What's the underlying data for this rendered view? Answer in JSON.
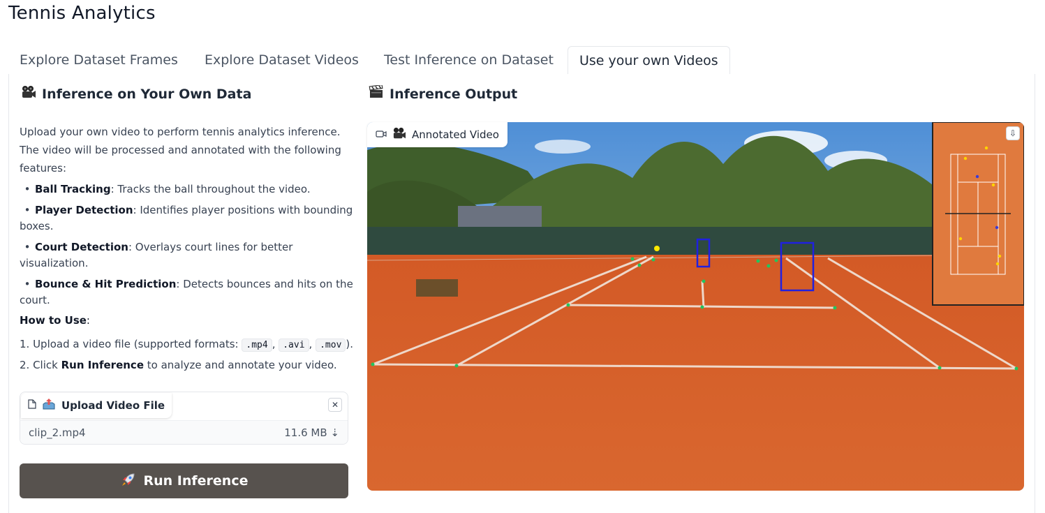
{
  "app": {
    "title": "Tennis Analytics"
  },
  "tabs": [
    {
      "label": "Explore Dataset Frames",
      "active": false
    },
    {
      "label": "Explore Dataset Videos",
      "active": false
    },
    {
      "label": "Test Inference on Dataset",
      "active": false
    },
    {
      "label": "Use your own Videos",
      "active": true
    }
  ],
  "left": {
    "title": "Inference on Your Own Data",
    "title_icon": "camera-emoji-icon",
    "description": "Upload your own video to perform tennis analytics inference. The video will be processed and annotated with the following features:",
    "features": [
      {
        "name": "Ball Tracking",
        "text": ": Tracks the ball throughout the video."
      },
      {
        "name": "Player Detection",
        "text": ": Identifies player positions with bounding boxes."
      },
      {
        "name": "Court Detection",
        "text": ": Overlays court lines for better visualization."
      },
      {
        "name": "Bounce & Hit Prediction",
        "text": ": Detects bounces and hits on the court."
      }
    ],
    "howto": {
      "label": "How to Use",
      "suffix": ":"
    },
    "steps": {
      "step1_prefix": "1. Upload a video file (supported formats: ",
      "formats": [
        ".mp4",
        ".avi",
        ".mov"
      ],
      "sep": ", ",
      "step1_suffix": ").",
      "step2_prefix": "2. Click ",
      "step2_bold": "Run Inference",
      "step2_suffix": " to analyze and annotate your video."
    },
    "upload": {
      "label": "Upload Video File",
      "file_name": "clip_2.mp4",
      "file_size": "11.6 MB",
      "download_glyph": "⇣",
      "clear_glyph": "✕"
    },
    "run_button": {
      "label": "Run Inference",
      "icon": "rocket-icon"
    }
  },
  "right": {
    "title": "Inference Output",
    "title_icon": "clapper-board-icon",
    "video_label": "Annotated Video",
    "download_glyph": "⇩"
  },
  "colors": {
    "clay": "#d8622c",
    "minimap": "#e07a3e",
    "player_box": "#2020e0",
    "keypoint": "#22c55e",
    "ball": "#ffea00",
    "button_bg": "#57524e"
  }
}
